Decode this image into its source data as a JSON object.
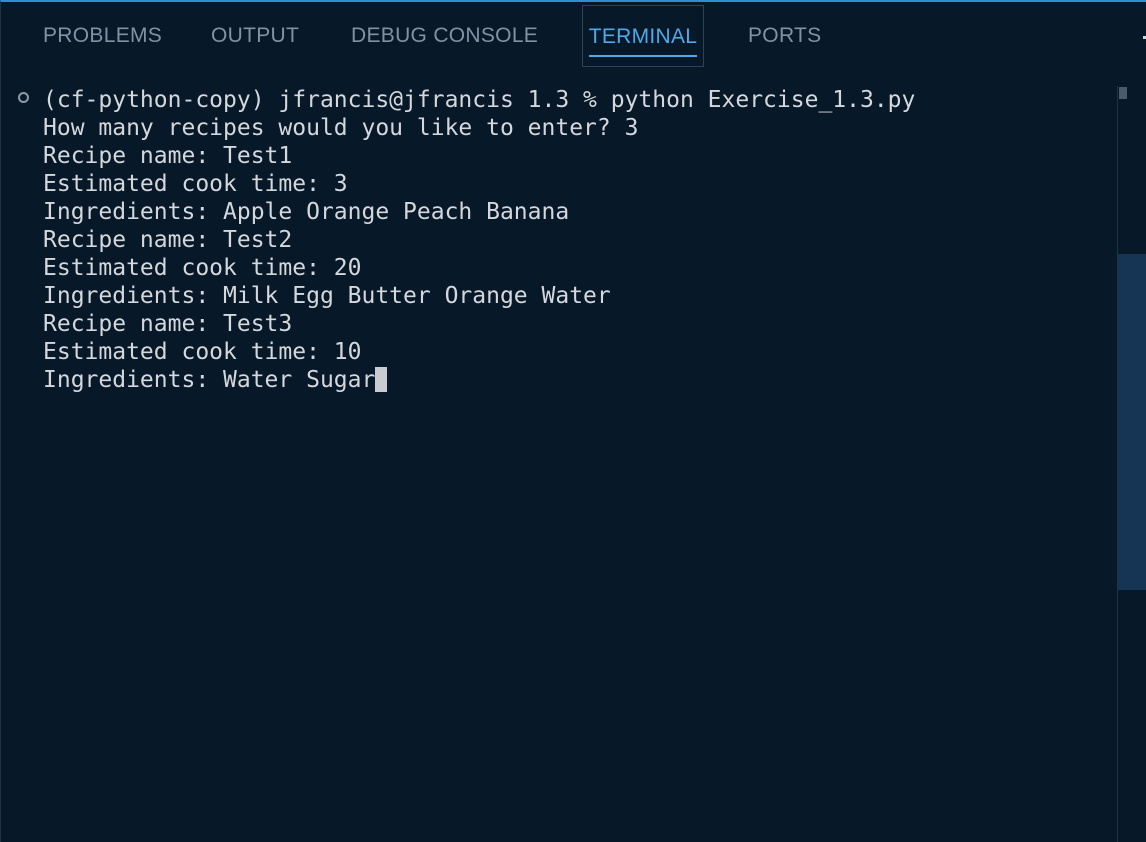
{
  "tabs": [
    {
      "label": "PROBLEMS"
    },
    {
      "label": "OUTPUT"
    },
    {
      "label": "DEBUG CONSOLE"
    },
    {
      "label": "TERMINAL"
    },
    {
      "label": "PORTS"
    }
  ],
  "active_tab": "TERMINAL",
  "terminal": {
    "lines": [
      "(cf-python-copy) jfrancis@jfrancis 1.3 % python Exercise_1.3.py",
      "How many recipes would you like to enter? 3",
      "Recipe name: Test1",
      "Estimated cook time: 3",
      "Ingredients: Apple Orange Peach Banana",
      "Recipe name: Test2",
      "Estimated cook time: 20",
      "Ingredients: Milk Egg Butter Orange Water",
      "Recipe name: Test3",
      "Estimated cook time: 10",
      "Ingredients: Water Sugar"
    ]
  },
  "colors": {
    "background": "#071828",
    "active_tab": "#4fa8e8",
    "inactive_tab": "#7f93a6",
    "terminal_text": "#d4d7db",
    "top_border": "#2a8fd6"
  },
  "icons": {
    "status": "circle-outline-icon",
    "cursor": "block-cursor"
  }
}
